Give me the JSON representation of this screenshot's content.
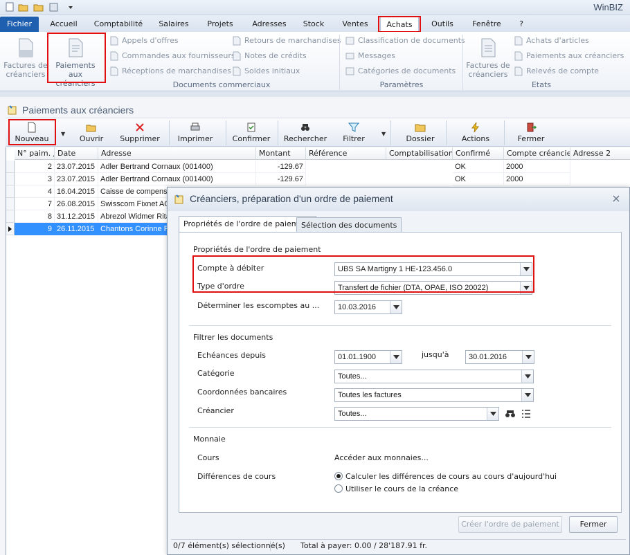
{
  "app": {
    "title": "WinBIZ"
  },
  "ribbon_tabs": [
    {
      "label": "Fichier"
    },
    {
      "label": "Accueil"
    },
    {
      "label": "Comptabilité"
    },
    {
      "label": "Salaires"
    },
    {
      "label": "Projets"
    },
    {
      "label": "Adresses"
    },
    {
      "label": "Stock"
    },
    {
      "label": "Ventes"
    },
    {
      "label": "Achats"
    },
    {
      "label": "Outils"
    },
    {
      "label": "Fenêtre"
    },
    {
      "label": "?"
    }
  ],
  "ribbon": {
    "big_factures": "Factures de créanciers",
    "big_paiements": "Paiements aux créanciers",
    "appels": "Appels d'offres",
    "commandes": "Commandes aux fournisseurs",
    "receptions": "Réceptions de marchandises",
    "retours": "Retours de marchandises",
    "notes": "Notes de crédits",
    "soldes": "Soldes initiaux",
    "group_docs": "Documents commerciaux",
    "classification": "Classification de documents",
    "messages": "Messages",
    "categories": "Catégories de documents",
    "group_params": "Paramètres",
    "big_factures2": "Factures de créanciers",
    "achats_articles": "Achats d'articles",
    "paiements_creanciers": "Paiements aux créanciers",
    "releves": "Relevés de compte",
    "group_etats": "Etats"
  },
  "panel": {
    "title": "Paiements aux créanciers"
  },
  "toolbar": {
    "nouveau": "Nouveau",
    "ouvrir": "Ouvrir",
    "supprimer": "Supprimer",
    "imprimer": "Imprimer",
    "confirmer": "Confirmer",
    "rechercher": "Rechercher",
    "filtrer": "Filtrer",
    "dossier": "Dossier",
    "actions": "Actions",
    "fermer": "Fermer"
  },
  "grid": {
    "headers": [
      "N° paim. ▲",
      "Date",
      "Adresse",
      "Montant",
      "Référence",
      "Comptabilisation",
      "Confirmé",
      "Compte créancier",
      "Adresse 2"
    ],
    "rows": [
      {
        "num": "2",
        "date": "23.07.2015",
        "adresse": "Adler Bertrand Cornaux (001400)",
        "montant": "-129.67",
        "confirme": "OK",
        "compte": "2000"
      },
      {
        "num": "3",
        "date": "23.07.2015",
        "adresse": "Adler Bertrand Cornaux (001400)",
        "montant": "-129.67",
        "confirme": "OK",
        "compte": "2000"
      },
      {
        "num": "4",
        "date": "16.04.2015",
        "adresse": "Caisse de compensa",
        "montant": "",
        "confirme": "",
        "compte": ""
      },
      {
        "num": "7",
        "date": "26.08.2015",
        "adresse": "Swisscom Fixnet AG",
        "montant": "",
        "confirme": "",
        "compte": ""
      },
      {
        "num": "8",
        "date": "31.12.2015",
        "adresse": "Abrezol Widmer Rita",
        "montant": "",
        "confirme": "",
        "compte": ""
      },
      {
        "num": "9",
        "date": "26.11.2015",
        "adresse": "Chantons Corinne Fo",
        "montant": "",
        "confirme": "",
        "compte": ""
      }
    ]
  },
  "dialog": {
    "title": "Créanciers, préparation d'un ordre de paiement",
    "tab1": "Propriétés de l'ordre de paiement",
    "tab2": "Sélection des documents",
    "sec1": "Propriétés de l'ordre de paiement",
    "compte_label": "Compte à débiter",
    "compte_value": "UBS SA Martigny 1 HE-123.456.0",
    "type_label": "Type d'ordre",
    "type_value": "Transfert de fichier (DTA, OPAE, ISO 20022)",
    "escomptes_label": "Déterminer les escomptes au ...",
    "escomptes_value": "10.03.2016",
    "sec2": "Filtrer les documents",
    "echeances_label": "Echéances depuis",
    "echeances_from": "01.01.1900",
    "jusqua_label": "jusqu'à",
    "echeances_to": "30.01.2016",
    "categorie_label": "Catégorie",
    "categorie_value": "Toutes...",
    "coord_label": "Coordonnées bancaires",
    "coord_value": "Toutes les factures",
    "creancier_label": "Créancier",
    "creancier_value": "Toutes...",
    "sec3": "Monnaie",
    "cours_label": "Cours",
    "cours_link": "Accéder aux monnaies...",
    "diff_label": "Différences de cours",
    "radio1": "Calculer les différences de cours au cours d'aujourd'hui",
    "radio2": "Utiliser le cours de la créance",
    "btn_creer": "Créer l'ordre de paiement",
    "btn_fermer": "Fermer",
    "status_left": "0/7 élément(s) sélectionné(s)",
    "status_right": "Total à payer: 0.00 / 28'187.91  fr."
  },
  "colors": {
    "accent": "#1f5fb0",
    "highlight": "#e01010",
    "selection": "#3390ff"
  }
}
